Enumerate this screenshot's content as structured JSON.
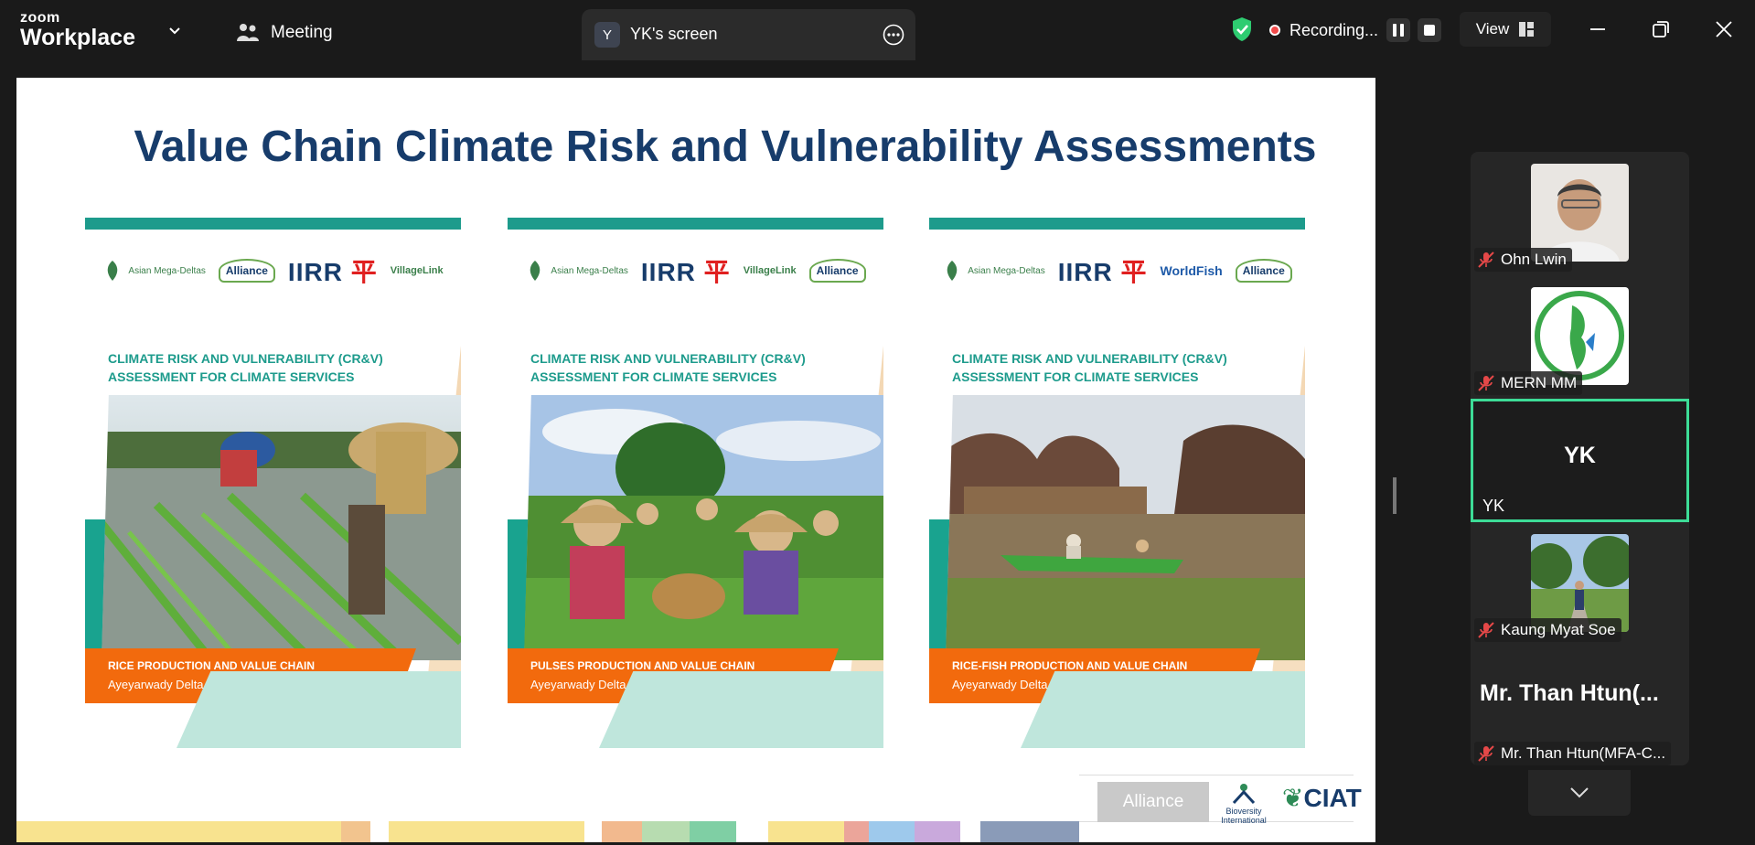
{
  "topbar": {
    "brand_small": "zoom",
    "brand_big": "Workplace",
    "meeting_label": "Meeting",
    "screen_tab": {
      "initial": "Y",
      "label": "YK's screen"
    },
    "recording_label": "Recording...",
    "view_label": "View"
  },
  "slide": {
    "title": "Value Chain Climate Risk and Vulnerability Assessments",
    "cards": [
      {
        "logos": [
          "Asian Mega-Deltas",
          "Alliance",
          "IIRR",
          "VillageLink"
        ],
        "header_line1": "CLIMATE RISK AND VULNERABILITY (CR&V)",
        "header_line2": "ASSESSMENT FOR CLIMATE SERVICES",
        "banner_title": "RICE PRODUCTION AND VALUE CHAIN",
        "banner_sub": "Ayeyarwady Delta, Myanmar"
      },
      {
        "logos": [
          "Asian Mega-Deltas",
          "IIRR",
          "VillageLink",
          "Alliance"
        ],
        "header_line1": "CLIMATE RISK AND VULNERABILITY (CR&V)",
        "header_line2": "ASSESSMENT FOR CLIMATE SERVICES",
        "banner_title": "PULSES PRODUCTION AND VALUE CHAIN",
        "banner_sub": "Ayeyarwady Delta, Myanmar"
      },
      {
        "logos": [
          "Asian Mega-Deltas",
          "IIRR",
          "WorldFish",
          "Alliance"
        ],
        "header_line1": "CLIMATE RISK AND VULNERABILITY (CR&V)",
        "header_line2": "ASSESSMENT FOR CLIMATE SERVICES",
        "banner_title": "RICE-FISH PRODUCTION AND VALUE CHAIN",
        "banner_sub": "Ayeyarwady Delta, Myanmar"
      }
    ],
    "footer": {
      "alliance": "Alliance",
      "bioversity": "Bioversity International",
      "ciat": "CIAT"
    }
  },
  "participants": [
    {
      "name": "Ohn Lwin",
      "muted": true
    },
    {
      "name": "MERN MM",
      "muted": true
    },
    {
      "name": "YK",
      "initials": "YK",
      "active": true
    },
    {
      "name": "Kaung Myat Soe",
      "muted": true
    },
    {
      "name": "Mr. Than Htun(MFA-C...",
      "display": "Mr. Than Htun(...",
      "muted": true
    }
  ],
  "colors": {
    "speaker_border": "#3ddc97",
    "shield": "#2ecc71",
    "record": "#f24b4b",
    "banner": "#f26a0d",
    "teal": "#1d9b8c",
    "title": "#173c6b"
  }
}
